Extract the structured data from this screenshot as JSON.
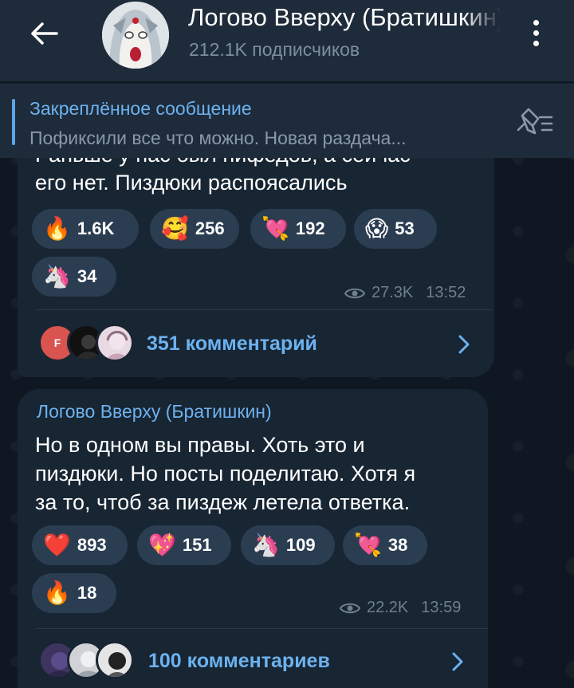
{
  "header": {
    "title": "Логово Вверху (Братишкин)",
    "subtitle": "212.1K подписчиков"
  },
  "pinned": {
    "title": "Закреплённое сообщение",
    "text": "Пофиксили все что можно. Новая раздача..."
  },
  "message1": {
    "partial_line": "Раньше у нас был нифедов, а сейчас",
    "last_line": "его нет. Пиздюки распоясались",
    "reactions": [
      {
        "emoji": "🔥",
        "count": "1.6K"
      },
      {
        "emoji": "🥰",
        "count": "256"
      },
      {
        "emoji": "💘",
        "count": "192"
      },
      {
        "emoji": "😱",
        "count": "53"
      },
      {
        "emoji": "🦄",
        "count": "34"
      }
    ],
    "views": "27.3K",
    "time": "13:52",
    "commenter_initial": "F",
    "comments": "351 комментарий"
  },
  "message2": {
    "author": "Логово Вверху (Братишкин)",
    "lines": [
      "Но в одном вы правы. Хоть это и",
      "пиздюки. Но посты поделитаю. Хотя я",
      "за то, чтоб за пиздеж летела ответка."
    ],
    "reactions": [
      {
        "emoji": "❤️",
        "count": "893"
      },
      {
        "emoji": "💖",
        "count": "151"
      },
      {
        "emoji": "🦄",
        "count": "109"
      },
      {
        "emoji": "💘",
        "count": "38"
      },
      {
        "emoji": "🔥",
        "count": "18"
      }
    ],
    "views": "22.2K",
    "time": "13:59",
    "comments": "100 комментариев"
  },
  "colors": {
    "header_bg": "#1e2b3a",
    "bubble_bg": "#182533",
    "accent": "#6cb2ef",
    "reaction_bg": "#2b3d51"
  }
}
